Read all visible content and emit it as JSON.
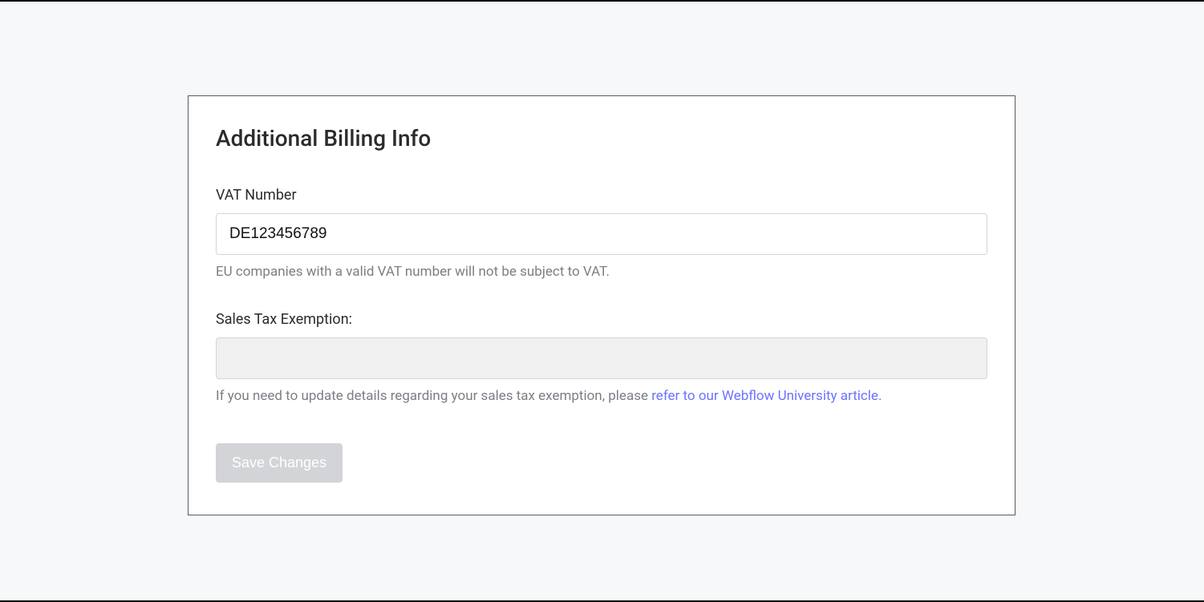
{
  "panel": {
    "title": "Additional Billing Info",
    "vat": {
      "label": "VAT Number",
      "value": "DE123456789",
      "helper": "EU companies with a valid VAT number will not be subject to VAT."
    },
    "salesTax": {
      "label": "Sales Tax Exemption:",
      "value": "",
      "helperPrefix": "If you need to update details regarding your sales tax exemption, please ",
      "helperLinkText": "refer to our Webflow University article."
    },
    "saveButton": "Save Changes"
  }
}
